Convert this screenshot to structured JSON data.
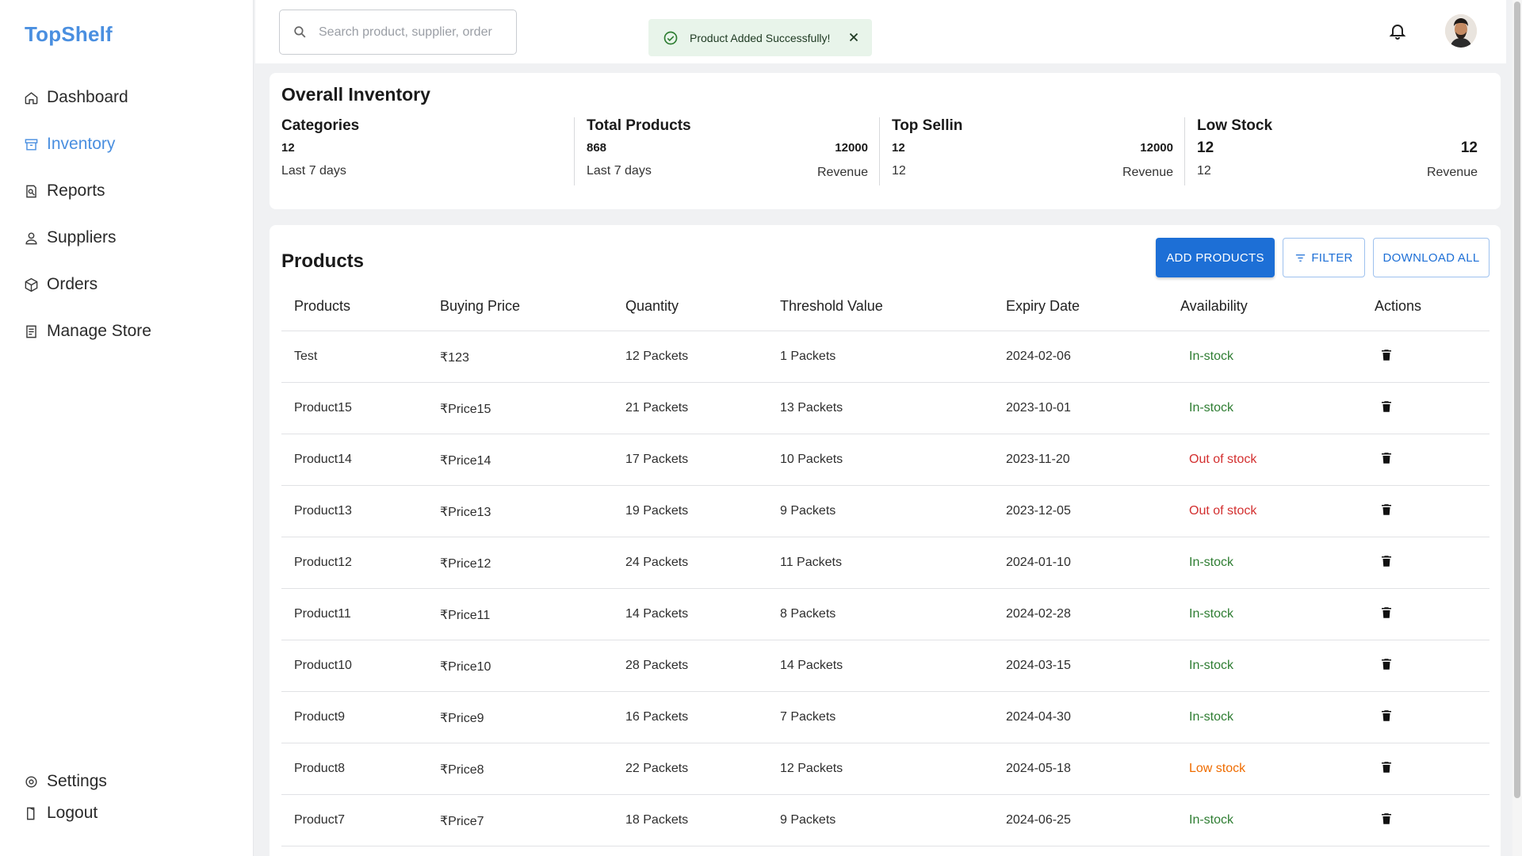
{
  "brand": "TopShelf",
  "sidebar": {
    "items": [
      {
        "label": "Dashboard",
        "icon": "home-icon"
      },
      {
        "label": "Inventory",
        "icon": "inventory-icon",
        "active": true
      },
      {
        "label": "Reports",
        "icon": "reports-icon"
      },
      {
        "label": "Suppliers",
        "icon": "user-icon"
      },
      {
        "label": "Orders",
        "icon": "box-icon"
      },
      {
        "label": "Manage Store",
        "icon": "store-icon"
      }
    ],
    "bottom": [
      {
        "label": "Settings",
        "icon": "gear-icon"
      },
      {
        "label": "Logout",
        "icon": "logout-icon"
      }
    ]
  },
  "header": {
    "search_placeholder": "Search product, supplier, order",
    "toast": "Product Added Successfully!"
  },
  "overall": {
    "title": "Overall Inventory",
    "stats": [
      {
        "label": "Categories",
        "value": "12",
        "sub": "Last 7 days"
      },
      {
        "label": "Total Products",
        "value": "868",
        "value_right": "12000",
        "sub": "Last 7 days",
        "sub_right": "Revenue"
      },
      {
        "label": "Top Sellin",
        "value": "12",
        "value_right": "12000",
        "sub": "12",
        "sub_right": "Revenue"
      },
      {
        "label": "Low Stock",
        "value": "12",
        "value_right": "12",
        "sub": "12",
        "sub_right": "Revenue"
      }
    ]
  },
  "products": {
    "title": "Products",
    "add_label": "ADD PRODUCTS",
    "filter_label": "FILTER",
    "download_label": "DOWNLOAD ALL",
    "columns": [
      "Products",
      "Buying Price",
      "Quantity",
      "Threshold Value",
      "Expiry Date",
      "Availability",
      "Actions"
    ],
    "rows": [
      {
        "name": "Test",
        "price": "₹123",
        "qty": "12 Packets",
        "threshold": "1 Packets",
        "expiry": "2024-02-06",
        "availability": "In-stock",
        "status": "in"
      },
      {
        "name": "Product15",
        "price": "₹Price15",
        "qty": "21 Packets",
        "threshold": "13 Packets",
        "expiry": "2023-10-01",
        "availability": "In-stock",
        "status": "in"
      },
      {
        "name": "Product14",
        "price": "₹Price14",
        "qty": "17 Packets",
        "threshold": "10 Packets",
        "expiry": "2023-11-20",
        "availability": "Out of stock",
        "status": "out"
      },
      {
        "name": "Product13",
        "price": "₹Price13",
        "qty": "19 Packets",
        "threshold": "9 Packets",
        "expiry": "2023-12-05",
        "availability": "Out of stock",
        "status": "out"
      },
      {
        "name": "Product12",
        "price": "₹Price12",
        "qty": "24 Packets",
        "threshold": "11 Packets",
        "expiry": "2024-01-10",
        "availability": "In-stock",
        "status": "in"
      },
      {
        "name": "Product11",
        "price": "₹Price11",
        "qty": "14 Packets",
        "threshold": "8 Packets",
        "expiry": "2024-02-28",
        "availability": "In-stock",
        "status": "in"
      },
      {
        "name": "Product10",
        "price": "₹Price10",
        "qty": "28 Packets",
        "threshold": "14 Packets",
        "expiry": "2024-03-15",
        "availability": "In-stock",
        "status": "in"
      },
      {
        "name": "Product9",
        "price": "₹Price9",
        "qty": "16 Packets",
        "threshold": "7 Packets",
        "expiry": "2024-04-30",
        "availability": "In-stock",
        "status": "in"
      },
      {
        "name": "Product8",
        "price": "₹Price8",
        "qty": "22 Packets",
        "threshold": "12 Packets",
        "expiry": "2024-05-18",
        "availability": "Low stock",
        "status": "low"
      },
      {
        "name": "Product7",
        "price": "₹Price7",
        "qty": "18 Packets",
        "threshold": "9 Packets",
        "expiry": "2024-06-25",
        "availability": "In-stock",
        "status": "in"
      }
    ]
  },
  "colors": {
    "accent": "#1d6fd6",
    "brand": "#4a8fe0",
    "in_stock": "#2e7d32",
    "out_of_stock": "#d32f2f",
    "low_stock": "#ef6c00"
  }
}
